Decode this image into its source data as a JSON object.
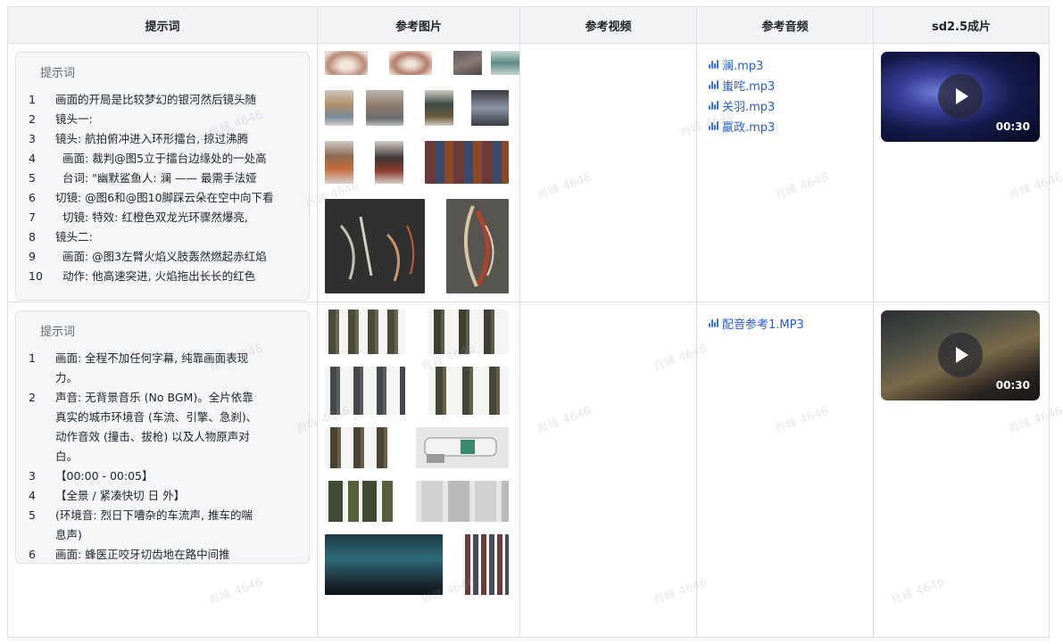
{
  "headers": [
    "提示词",
    "参考图片",
    "参考视频",
    "参考音频",
    "sd2.5成片"
  ],
  "watermark": "肖峰 4646",
  "rows": [
    {
      "prompt_label": "提示词",
      "prompt_lines": [
        {
          "n": "1",
          "t": "画面的开局是比较梦幻的银河然后镜头随"
        },
        {
          "n": "2",
          "t": "镜头一:"
        },
        {
          "n": "3",
          "t": "镜头: 航拍俯冲进入环形擂台, 掠过沸腾"
        },
        {
          "n": "4",
          "t": "  画面: 裁判@图5立于擂台边缘处的一处高"
        },
        {
          "n": "5",
          "t": "  台词: \"幽默鲨鱼人: 澜 —— 最需手法娅"
        },
        {
          "n": "6",
          "t": "切镜: @图6和@图10脚踩云朵在空中向下看"
        },
        {
          "n": "7",
          "t": "  切镜: 特效: 红橙色双龙光环骤然爆亮,"
        },
        {
          "n": "8",
          "t": "镜头二:"
        },
        {
          "n": "9",
          "t": "  画面: @图3左臂火焰义肢轰然燃起赤红焰"
        },
        {
          "n": "10",
          "t": "  动作: 他高速突进, 火焰拖出长长的红色"
        }
      ],
      "audio": [
        "澜.mp3",
        "蚩咤.mp3",
        "关羽.mp3",
        "嬴政.mp3"
      ],
      "video_duration": "00:30"
    },
    {
      "prompt_label": "提示词",
      "prompt_lines": [
        {
          "n": "1",
          "t": "画面: 全程不加任何字幕, 纯靠画面表现力。"
        },
        {
          "n": "2",
          "t": "  声音: 无背景音乐 (No BGM)。全片依靠真实的城市环境音 (车流、引擎、急刹)、动作音效 (撞击、拔枪) 以及人物原声对白。"
        },
        {
          "n": "3",
          "t": "【00:00 - 00:05】"
        },
        {
          "n": "4",
          "t": "【全景 / 紧凑快切 日 外】"
        },
        {
          "n": "5",
          "t": "(环境音: 烈日下嘈杂的车流声, 推车的喘息声)"
        },
        {
          "n": "6",
          "t": "画面: 蜂医正咬牙切齿地在路中间推"
        }
      ],
      "audio": [
        "配音参考1.MP3"
      ],
      "video_duration": "00:30"
    }
  ]
}
